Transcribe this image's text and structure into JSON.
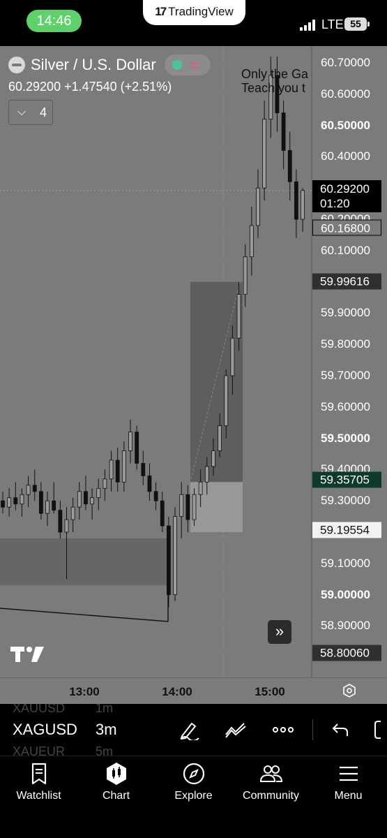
{
  "status_bar": {
    "time": "14:46",
    "network": "LTE",
    "battery": "55",
    "app_pill": "TradingView"
  },
  "chart": {
    "symbol_name": "Silver / U.S. Dollar",
    "price_line": "60.29200  +1.47540 (+2.51%)",
    "indicator_count": "4",
    "note_line1": "Only the Ga",
    "note_line2": "Teach you t",
    "price_axis": [
      {
        "label": "60.70000",
        "value": 60.7,
        "bold": false
      },
      {
        "label": "60.60000",
        "value": 60.6,
        "bold": false
      },
      {
        "label": "60.50000",
        "value": 60.5,
        "bold": true
      },
      {
        "label": "60.40000",
        "value": 60.4,
        "bold": false
      },
      {
        "label": "60.20000",
        "value": 60.2,
        "bold": false
      },
      {
        "label": "60.10000",
        "value": 60.1,
        "bold": false
      },
      {
        "label": "59.90000",
        "value": 59.9,
        "bold": false
      },
      {
        "label": "59.80000",
        "value": 59.8,
        "bold": false
      },
      {
        "label": "59.70000",
        "value": 59.7,
        "bold": false
      },
      {
        "label": "59.60000",
        "value": 59.6,
        "bold": false
      },
      {
        "label": "59.50000",
        "value": 59.5,
        "bold": true
      },
      {
        "label": "59.40000",
        "value": 59.4,
        "bold": false
      },
      {
        "label": "59.30000",
        "value": 59.3,
        "bold": false
      },
      {
        "label": "59.10000",
        "value": 59.1,
        "bold": false
      },
      {
        "label": "59.00000",
        "value": 59.0,
        "bold": true
      },
      {
        "label": "58.90000",
        "value": 58.9,
        "bold": false
      }
    ],
    "tags": {
      "current_price": "60.29200",
      "countdown": "01:20",
      "outline_price": "60.16800",
      "dark_price_1": "59.99616",
      "green_price": "59.35705",
      "white_price": "59.19554",
      "dark_price_2": "58.80060"
    },
    "time_axis": [
      "13:00",
      "14:00",
      "15:00"
    ],
    "scroll_button": "»"
  },
  "chart_data": {
    "type": "candlestick",
    "symbol": "XAGUSD",
    "interval": "3m",
    "y_range": [
      58.8,
      60.75
    ],
    "x_ticks": [
      "13:00",
      "14:00",
      "15:00"
    ],
    "current_price": 60.292,
    "zones": [
      {
        "from": 59.36,
        "to": 60.0,
        "shade": "dark"
      },
      {
        "from": 59.2,
        "to": 59.36,
        "shade": "light"
      },
      {
        "from": 59.03,
        "to": 59.18,
        "shade": "dark"
      }
    ],
    "candles": [
      [
        59.3,
        59.33,
        59.26,
        59.28
      ],
      [
        59.28,
        59.34,
        59.25,
        59.31
      ],
      [
        59.31,
        59.36,
        59.27,
        59.29
      ],
      [
        59.29,
        59.34,
        59.25,
        59.32
      ],
      [
        59.32,
        59.38,
        59.28,
        59.35
      ],
      [
        59.35,
        59.4,
        59.3,
        59.33
      ],
      [
        59.33,
        59.36,
        59.24,
        59.26
      ],
      [
        59.26,
        59.33,
        59.22,
        59.3
      ],
      [
        59.3,
        59.36,
        59.26,
        59.27
      ],
      [
        59.27,
        59.3,
        59.18,
        59.2
      ],
      [
        59.2,
        59.28,
        59.05,
        59.24
      ],
      [
        59.24,
        59.31,
        59.2,
        59.28
      ],
      [
        59.28,
        59.36,
        59.24,
        59.33
      ],
      [
        59.33,
        59.38,
        59.27,
        59.29
      ],
      [
        59.29,
        59.34,
        59.24,
        59.31
      ],
      [
        59.31,
        59.37,
        59.27,
        59.34
      ],
      [
        59.34,
        59.4,
        59.3,
        59.37
      ],
      [
        59.37,
        59.46,
        59.33,
        59.43
      ],
      [
        59.43,
        59.47,
        59.33,
        59.36
      ],
      [
        59.36,
        59.49,
        59.33,
        59.46
      ],
      [
        59.46,
        59.56,
        59.42,
        59.52
      ],
      [
        59.52,
        59.54,
        59.4,
        59.42
      ],
      [
        59.42,
        59.46,
        59.35,
        59.38
      ],
      [
        59.38,
        59.42,
        59.3,
        59.33
      ],
      [
        59.33,
        59.36,
        59.27,
        59.3
      ],
      [
        59.3,
        59.33,
        59.2,
        59.22
      ],
      [
        59.22,
        59.25,
        58.96,
        59.0
      ],
      [
        59.0,
        59.28,
        58.98,
        59.25
      ],
      [
        59.25,
        59.36,
        59.18,
        59.32
      ],
      [
        59.32,
        59.35,
        59.2,
        59.24
      ],
      [
        59.24,
        59.34,
        59.22,
        59.32
      ],
      [
        59.32,
        59.4,
        59.28,
        59.36
      ],
      [
        59.36,
        59.44,
        59.32,
        59.41
      ],
      [
        59.41,
        59.5,
        59.38,
        59.46
      ],
      [
        59.46,
        59.58,
        59.44,
        59.54
      ],
      [
        59.54,
        59.72,
        59.5,
        59.7
      ],
      [
        59.7,
        59.86,
        59.64,
        59.82
      ],
      [
        59.82,
        60.0,
        59.78,
        59.96
      ],
      [
        59.96,
        60.12,
        59.92,
        60.08
      ],
      [
        60.08,
        60.24,
        60.02,
        60.18
      ],
      [
        60.18,
        60.36,
        60.14,
        60.3
      ],
      [
        60.3,
        60.58,
        60.26,
        60.52
      ],
      [
        60.52,
        60.72,
        60.46,
        60.66
      ],
      [
        60.66,
        60.72,
        60.48,
        60.54
      ],
      [
        60.54,
        60.58,
        60.36,
        60.42
      ],
      [
        60.42,
        60.48,
        60.26,
        60.32
      ],
      [
        60.32,
        60.36,
        60.14,
        60.2
      ],
      [
        60.2,
        60.3,
        60.16,
        60.292
      ]
    ]
  },
  "toolbar": {
    "symbol": "XAGUSD",
    "interval": "3m",
    "ghost_symbol_above": "XAUUSD",
    "ghost_interval_above": "1m",
    "ghost_symbol_below": "XAUEUR",
    "ghost_interval_below": "5m"
  },
  "nav": [
    {
      "label": "Watchlist",
      "icon": "watchlist-icon"
    },
    {
      "label": "Chart",
      "icon": "chart-icon"
    },
    {
      "label": "Explore",
      "icon": "compass-icon"
    },
    {
      "label": "Community",
      "icon": "community-icon"
    },
    {
      "label": "Menu",
      "icon": "menu-icon"
    }
  ]
}
